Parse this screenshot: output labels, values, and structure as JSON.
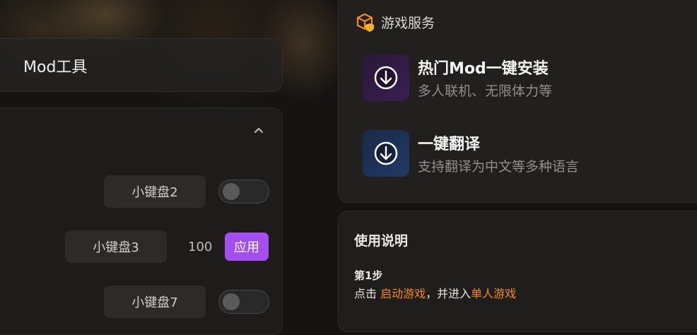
{
  "colors": {
    "accent_purple": "#a44df0",
    "accent_orange": "#f08a2c",
    "panel_bg": "#242221",
    "text_primary": "#f0f0f0",
    "text_secondary": "#8f8f8f"
  },
  "mod_tool": {
    "title": "Mod工具"
  },
  "keys": {
    "collapse_icon": "chevron-up-icon",
    "rows": [
      {
        "label": "小键盘2",
        "control": "toggle",
        "enabled": false
      },
      {
        "label": "小键盘3",
        "control": "apply",
        "value": "100",
        "button_label": "应用"
      },
      {
        "label": "小键盘7",
        "control": "toggle",
        "enabled": false
      }
    ]
  },
  "game_service": {
    "header_icon": "box-shield-icon",
    "title": "游戏服务",
    "items": [
      {
        "title": "热门Mod一键安装",
        "subtitle": "多人联机、无限体力等",
        "icon": "download-icon"
      },
      {
        "title": "一键翻译",
        "subtitle": "支持翻译为中文等多种语言",
        "icon": "download-icon"
      }
    ]
  },
  "usage": {
    "title": "使用说明",
    "step": {
      "label": "第1步",
      "prefix": "点击 ",
      "link1": "启动游戏",
      "middle": "，并进入",
      "link2": "单人游戏"
    }
  }
}
